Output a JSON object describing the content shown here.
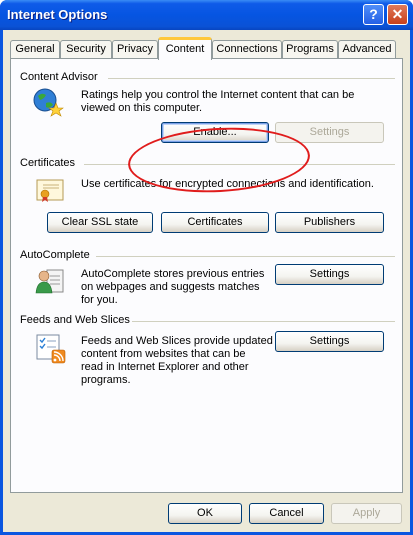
{
  "window": {
    "title": "Internet Options",
    "help_label": "?",
    "close_label": "✕"
  },
  "tabs": [
    {
      "label": "General"
    },
    {
      "label": "Security"
    },
    {
      "label": "Privacy"
    },
    {
      "label": "Content",
      "active": true
    },
    {
      "label": "Connections"
    },
    {
      "label": "Programs"
    },
    {
      "label": "Advanced"
    }
  ],
  "content_advisor": {
    "label": "Content Advisor",
    "desc_line1": "Ratings help you control the Internet content that can be",
    "desc_line2": "viewed on this computer.",
    "enable_label": "Enable...",
    "settings_label": "Settings",
    "icon": "globe-star-icon"
  },
  "certificates": {
    "label": "Certificates",
    "desc": "Use certificates for encrypted connections and identification.",
    "clear_ssl_label": "Clear SSL state",
    "certificates_label": "Certificates",
    "publishers_label": "Publishers",
    "icon": "certificate-icon"
  },
  "autocomplete": {
    "label": "AutoComplete",
    "desc_line1": "AutoComplete stores previous entries",
    "desc_line2": "on webpages and suggests matches",
    "desc_line3": "for you.",
    "settings_label": "Settings",
    "icon": "user-form-icon"
  },
  "feeds": {
    "label": "Feeds and Web Slices",
    "desc_line1": "Feeds and Web Slices provide updated",
    "desc_line2": "content from websites that can be",
    "desc_line3": "read in Internet Explorer and other",
    "desc_line4": "programs.",
    "settings_label": "Settings",
    "icon": "feeds-list-icon"
  },
  "footer": {
    "ok_label": "OK",
    "cancel_label": "Cancel",
    "apply_label": "Apply"
  },
  "colors": {
    "title_bar": "#0655e2",
    "dialog_bg": "#ece9d8",
    "active_tab_accent": "#ffc83c",
    "annotation": "#e01c1c"
  }
}
